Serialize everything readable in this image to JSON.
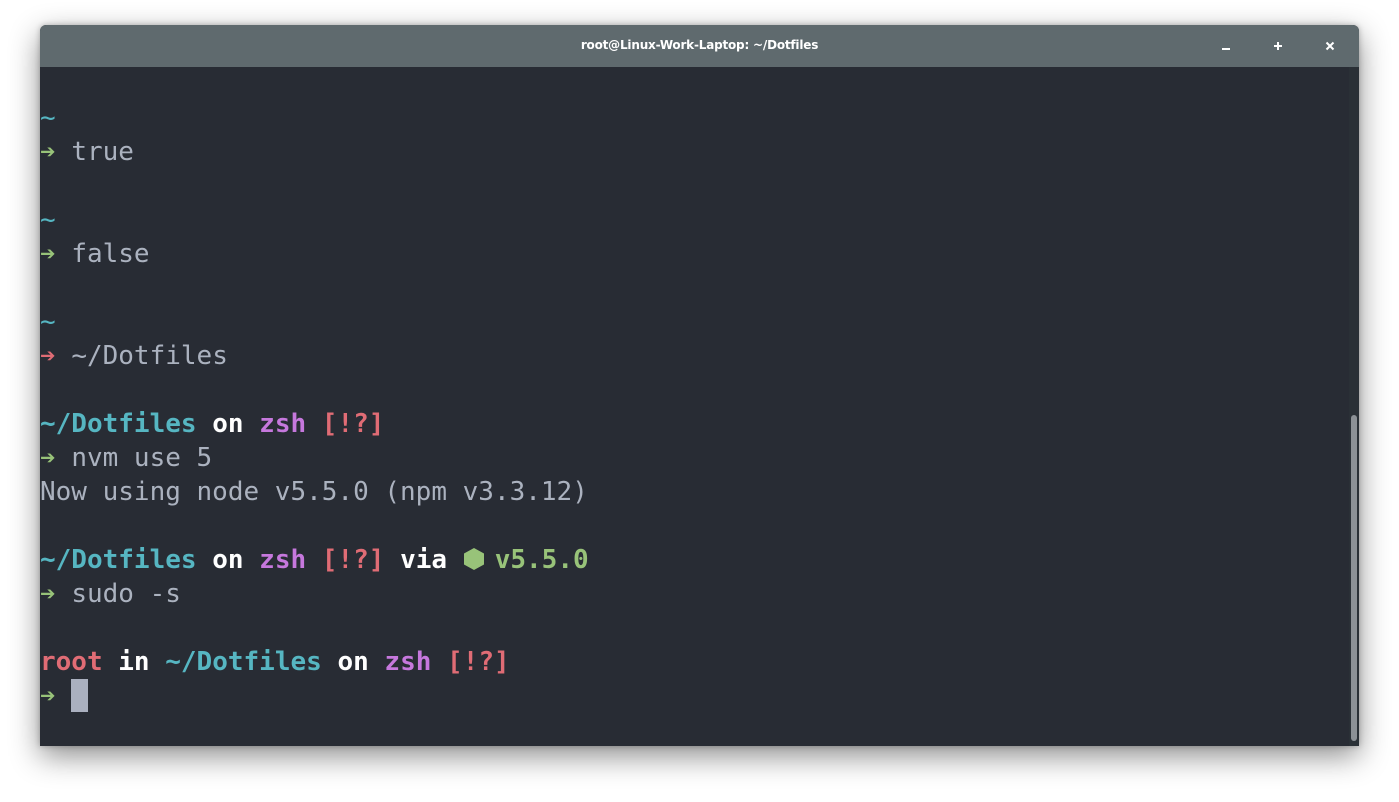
{
  "window": {
    "title": "root@Linux-Work-Laptop: ~/Dotfiles",
    "buttons": {
      "minimize": "minimize-icon",
      "maximize": "plus-icon",
      "close": "close-icon"
    }
  },
  "colors": {
    "background": "#282c34",
    "titlebar": "#5f6a6e",
    "foreground": "#abb2bf",
    "cyan": "#56b6c2",
    "green": "#98c379",
    "red": "#e06c75",
    "magenta": "#c678dd",
    "cursor": "#aab0bf"
  },
  "terminal": {
    "tilde": "~",
    "arrow": "➔",
    "block1": {
      "command": "true"
    },
    "block2": {
      "command": "false"
    },
    "block3": {
      "command": "~/Dotfiles"
    },
    "prompt": {
      "directory": "~/Dotfiles",
      "on": "on",
      "branch": "zsh",
      "status": "[!?]",
      "via": "via",
      "node_icon": "nodejs-hexagon-icon",
      "node_version": "v5.5.0",
      "user": "root",
      "in": "in"
    },
    "block4": {
      "command": "nvm use 5",
      "output": "Now using node v5.5.0 (npm v3.3.12)"
    },
    "block5": {
      "command": "sudo -s"
    },
    "block6": {
      "command": ""
    }
  }
}
